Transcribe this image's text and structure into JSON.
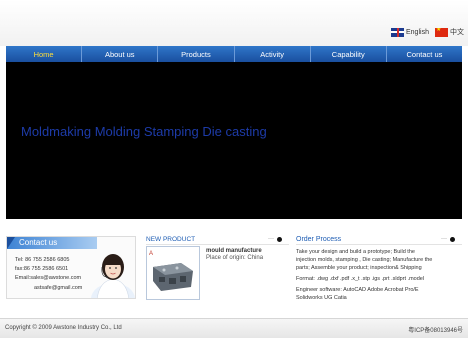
{
  "language": {
    "english": "English",
    "chinese": "中文"
  },
  "nav": {
    "items": [
      "Home",
      "About us",
      "Products",
      "Activity",
      "Capability",
      "Contact us"
    ]
  },
  "banner": {
    "text": "Moldmaking  Molding Stamping  Die casting"
  },
  "contact": {
    "title": "Contact us",
    "tel": "Tel: 86 755 2586 6805",
    "fax": "fax:86 755 2586 6501",
    "email1": "Email:sales@awstone.com",
    "email2": "astsafe@gmail.com"
  },
  "new_product": {
    "title": "NEW  PRODUCT",
    "more": "···",
    "product_name": "mould manufacture",
    "origin": "Place of origin: China"
  },
  "order_process": {
    "title": "Order  Process",
    "more": "···",
    "text1": "Take your design and build a prototype; Build the",
    "text2": "injection molds, stamping , Die casting; Manufacture the",
    "text3": "parts; Assemble your product; inspection& Shipping",
    "format": "Format: .dwg .dxf .pdf .x_t .stp .igs .prt .sldprt .model",
    "software1": "Engineer software: AutoCAD Adobe Acrobat Pro/E",
    "software2": "Solidworks UG Catia"
  },
  "footer": {
    "copyright": "Copyright © 2009 Awstone Industry Co., Ltd",
    "icp": "粤ICP备08013946号"
  },
  "colors": {
    "nav": "#1a4f9f",
    "nav_active": "#ffde3a",
    "banner": "#000000",
    "banner_text": "#1d3ba8",
    "heading": "#1d5cb3"
  }
}
